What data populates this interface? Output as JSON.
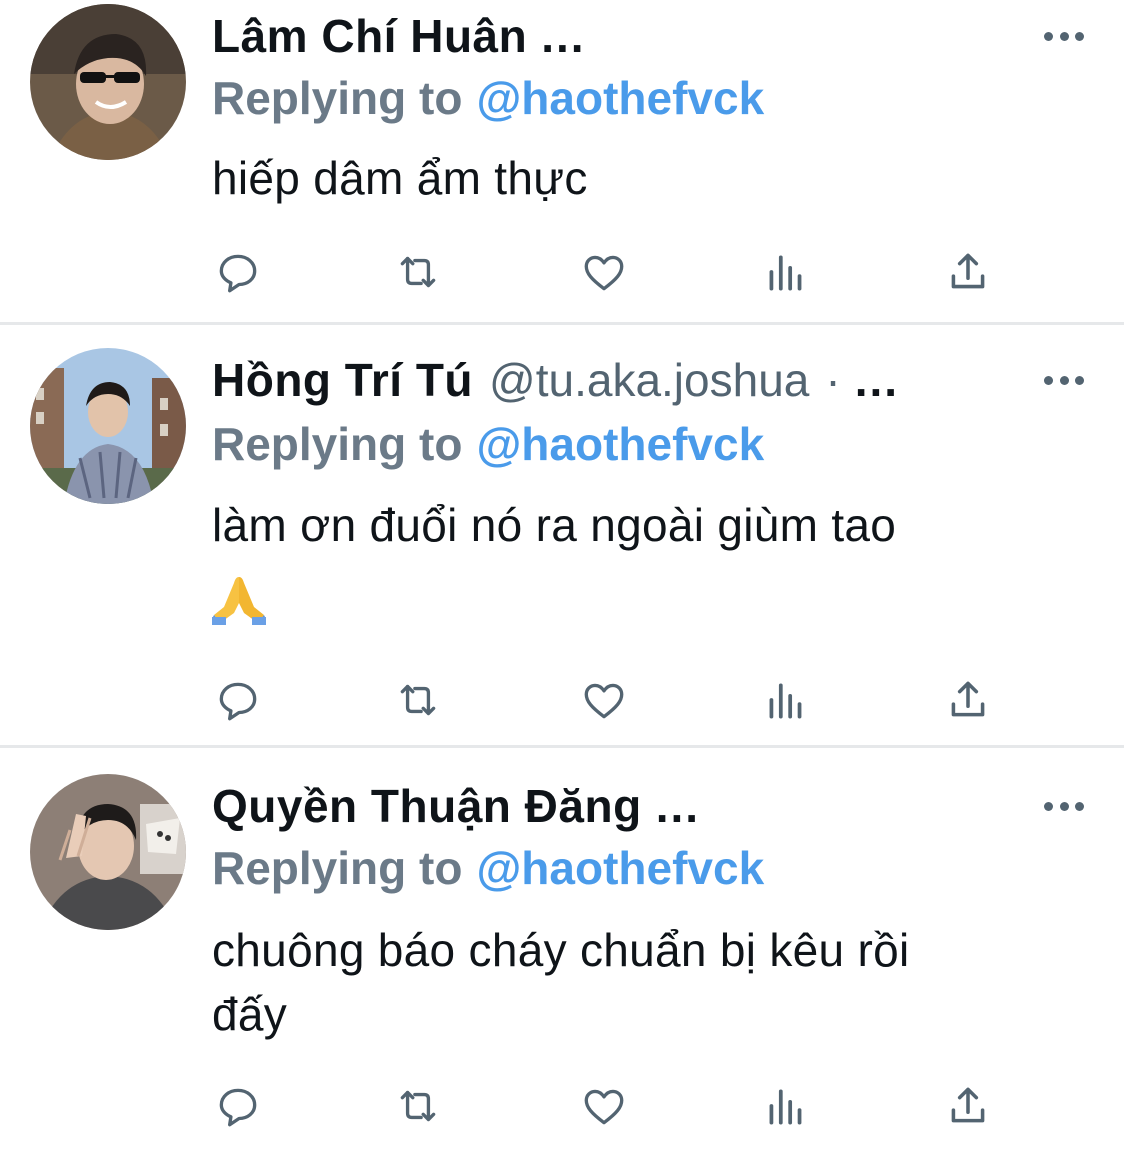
{
  "tweets": [
    {
      "name": "Lâm Chí Huân",
      "handle": "",
      "truncation": "...",
      "replying_label": "Replying to",
      "replying_handle": "@haothefvck",
      "text": "hiếp dâm ẩm thực",
      "emoji": ""
    },
    {
      "name": "Hồng Trí Tú",
      "handle": "@tu.aka.joshua",
      "separator": "·",
      "truncation": "...",
      "replying_label": "Replying to",
      "replying_handle": "@haothefvck",
      "text": "làm ơn đuổi nó ra ngoài giùm tao",
      "emoji": "🙏"
    },
    {
      "name": "Quyền Thuận Đăng",
      "handle": "",
      "truncation": "...",
      "replying_label": "Replying to",
      "replying_handle": "@haothefvck",
      "text_line1": "chuông báo cháy chuẩn bị kêu rồi",
      "text_line2": "đấy",
      "emoji": ""
    }
  ],
  "icons": {
    "more": "more-horizontal-icon",
    "reply": "reply-bubble-icon",
    "retweet": "retweet-icon",
    "like": "heart-icon",
    "views": "analytics-bars-icon",
    "share": "share-upload-icon"
  },
  "colors": {
    "text": "#0f1419",
    "secondary": "#536471",
    "mention": "#4a9bea",
    "divider": "#e6e8ea"
  }
}
